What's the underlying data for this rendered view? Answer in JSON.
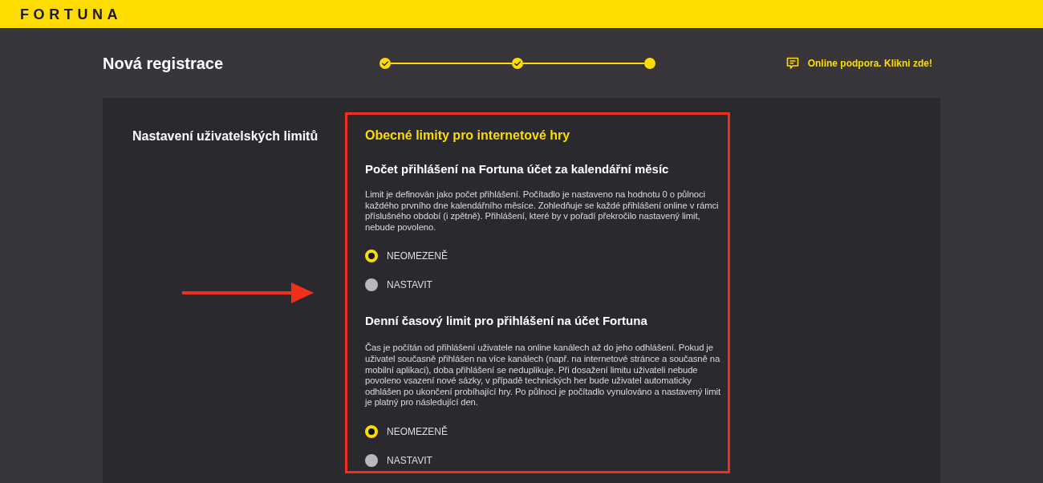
{
  "header": {
    "logo": "FORTUNA"
  },
  "page": {
    "title": "Nová registrace",
    "steps": [
      {
        "completed": true
      },
      {
        "completed": true
      },
      {
        "completed": false
      }
    ],
    "support_link": "Online podpora. Klikni zde!"
  },
  "limits": {
    "section_label": "Nastavení uživatelských limitů",
    "group_title": "Obecné limity pro internetové hry",
    "items": [
      {
        "title": "Počet přihlášení na Fortuna účet za kalendářní měsíc",
        "description": "Limit je definován jako počet přihlášení. Počítadlo je nastaveno na hodnotu 0 o půlnoci každého prvního dne kalendářního měsíce. Zohledňuje se každé přihlášení online v rámci příslušného období (i zpětně). Přihlášení, které by v pořadí překročilo nastavený limit, nebude povoleno.",
        "options": [
          {
            "label": "NEOMEZENĚ",
            "selected": true
          },
          {
            "label": "NASTAVIT",
            "selected": false
          }
        ]
      },
      {
        "title": "Denní časový limit pro přihlášení na účet Fortuna",
        "description": "Čas je počítán od přihlášení uživatele na online kanálech až do jeho odhlášení. Pokud je uživatel současně přihlášen na více kanálech (např. na internetové stránce a současně na mobilní aplikaci), doba přihlášení se neduplikuje. Při dosažení limitu uživateli nebude povoleno vsazení nové sázky, v případě technických her bude uživatel automaticky odhlášen po ukončení probíhající hry. Po půlnoci je počítadlo vynulováno a nastavený limit je platný pro následující den.",
        "options": [
          {
            "label": "NEOMEZENĚ",
            "selected": true
          },
          {
            "label": "NASTAVIT",
            "selected": false
          }
        ]
      }
    ]
  }
}
